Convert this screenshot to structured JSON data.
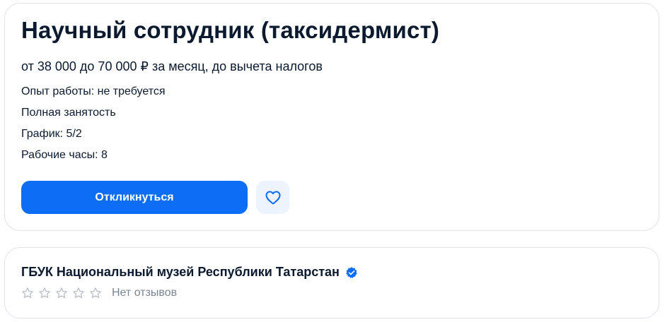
{
  "vacancy": {
    "title": "Научный сотрудник (таксидермист)",
    "salary": "от 38 000 до 70 000 ₽ за месяц, до вычета налогов",
    "details": [
      "Опыт работы: не требуется",
      "Полная занятость",
      "График: 5/2",
      "Рабочие часы: 8"
    ],
    "apply_label": "Откликнуться",
    "favorite_icon": "heart-icon"
  },
  "company": {
    "name": "ГБУК Национальный музей Республики Татарстан",
    "verified_icon": "verified-badge-icon",
    "rating_stars_filled": 0,
    "rating_stars_total": 5,
    "reviews_label": "Нет отзывов"
  },
  "colors": {
    "accent": "#0d6ef5",
    "favorite_bg": "#edf4ff",
    "text": "#0b1a2e",
    "muted": "#7a8593",
    "border": "#dfe3e8"
  }
}
